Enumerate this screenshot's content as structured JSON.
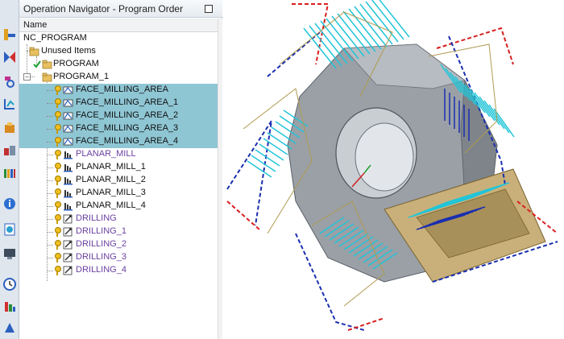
{
  "navigator": {
    "title": "Operation Navigator - Program Order",
    "column_header": "Name"
  },
  "tree": {
    "root": "NC_PROGRAM",
    "unused": "Unused Items",
    "program": "PROGRAM",
    "program_1": "PROGRAM_1",
    "operations": [
      {
        "label": "FACE_MILLING_AREA",
        "selected": true,
        "purple": false,
        "icon": "face-milling-icon"
      },
      {
        "label": "FACE_MILLING_AREA_1",
        "selected": true,
        "purple": false,
        "icon": "face-milling-icon"
      },
      {
        "label": "FACE_MILLING_AREA_2",
        "selected": true,
        "purple": false,
        "icon": "face-milling-icon"
      },
      {
        "label": "FACE_MILLING_AREA_3",
        "selected": true,
        "purple": false,
        "icon": "face-milling-icon"
      },
      {
        "label": "FACE_MILLING_AREA_4",
        "selected": true,
        "purple": false,
        "icon": "face-milling-icon"
      },
      {
        "label": "PLANAR_MILL",
        "selected": false,
        "purple": true,
        "icon": "planar-mill-icon"
      },
      {
        "label": "PLANAR_MILL_1",
        "selected": false,
        "purple": false,
        "icon": "planar-mill-icon"
      },
      {
        "label": "PLANAR_MILL_2",
        "selected": false,
        "purple": false,
        "icon": "planar-mill-icon"
      },
      {
        "label": "PLANAR_MILL_3",
        "selected": false,
        "purple": false,
        "icon": "planar-mill-icon"
      },
      {
        "label": "PLANAR_MILL_4",
        "selected": false,
        "purple": false,
        "icon": "planar-mill-icon"
      },
      {
        "label": "DRILLING",
        "selected": false,
        "purple": true,
        "icon": "drilling-icon"
      },
      {
        "label": "DRILLING_1",
        "selected": false,
        "purple": true,
        "icon": "drilling-icon"
      },
      {
        "label": "DRILLING_2",
        "selected": false,
        "purple": true,
        "icon": "drilling-icon"
      },
      {
        "label": "DRILLING_3",
        "selected": false,
        "purple": true,
        "icon": "drilling-icon"
      },
      {
        "label": "DRILLING_4",
        "selected": false,
        "purple": true,
        "icon": "drilling-icon"
      }
    ]
  },
  "resource_bar": [
    {
      "icon": "machine-tool-view-icon"
    },
    {
      "icon": "program-order-view-icon"
    },
    {
      "icon": "geometry-view-icon"
    },
    {
      "icon": "operation-navigator-icon"
    },
    {
      "icon": "part-navigator-icon"
    },
    {
      "icon": "reuse-library-icon"
    },
    {
      "icon": "history-icon"
    },
    {
      "icon": "system-materials-icon"
    },
    {
      "icon": "info-icon"
    },
    {
      "icon": "web-browser-icon"
    },
    {
      "icon": "display-icon"
    },
    {
      "icon": "clock-icon"
    },
    {
      "icon": "roles-icon"
    },
    {
      "icon": "process-studio-icon"
    }
  ],
  "colors": {
    "selection": "#8fc6d4",
    "toolpath_cyan": "#22c5d8",
    "toolpath_blue": "#1a2fb0",
    "rapid_red": "#d81e1e",
    "part_gray": "#9aa0a6",
    "fixture_tan": "#c9b07a"
  }
}
